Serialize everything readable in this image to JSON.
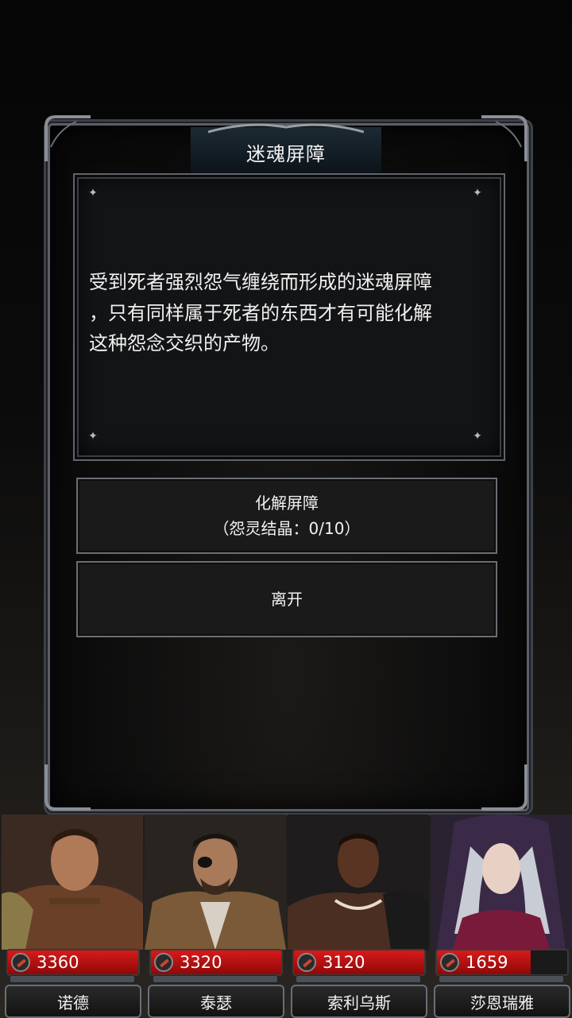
{
  "dialog": {
    "title": "迷魂屏障",
    "description_lines": [
      "受到死者强烈怨气缠绕而形成的迷魂屏障",
      "，只有同样属于死者的东西才有可能化解",
      "这种怨念交织的产物。"
    ],
    "resolve_button": {
      "label": "化解屏障",
      "requirement": "（怨灵结晶：0/10）"
    },
    "leave_button": {
      "label": "离开"
    }
  },
  "party": [
    {
      "name": "诺德",
      "hp": "3360",
      "hp_fill": 1.0
    },
    {
      "name": "泰瑟",
      "hp": "3320",
      "hp_fill": 1.0
    },
    {
      "name": "索利乌斯",
      "hp": "3120",
      "hp_fill": 1.0
    },
    {
      "name": "莎恩瑞雅",
      "hp": "1659",
      "hp_fill": 0.72
    }
  ],
  "colors": {
    "hp_red": "#d81a1a",
    "frame_steel": "#5a5e66"
  }
}
